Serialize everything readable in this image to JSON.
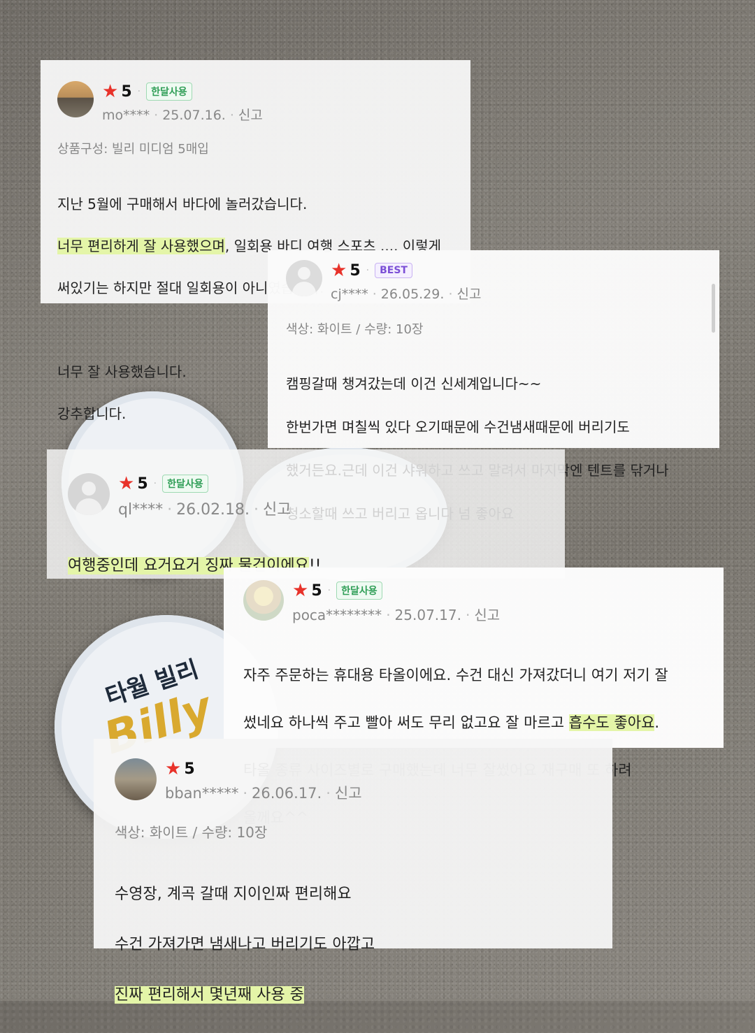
{
  "reviews": [
    {
      "score": "5",
      "badge": "한달사용",
      "user": "mo****",
      "date": "25.07.16.",
      "report": "신고",
      "option": "상품구성: 빌리 미디엄 5매입",
      "line1": "지난 5월에 구매해서 바다에 놀러갔습니다.",
      "line2_hl": "너무 편리하게 잘 사용했으며",
      "line2_rest": ", 일회용 바디 여행 스포츠 .... 이렇게",
      "line3": "써있기는 하지만 절대 일회용이 아니였습니다.",
      "line4": "너무 잘 사용했습니다.",
      "line5": "강추합니다."
    },
    {
      "score": "5",
      "badge": "BEST",
      "user": "cj****",
      "date": "26.05.29.",
      "report": "신고",
      "option": "색상: 화이트 / 수량: 10장",
      "line1": "캠핑갈때 챙겨갔는데 이건 신세계입니다~~",
      "line2": "한번가면 며칠씩 있다 오기때문에 수건냄새때문에 버리기도",
      "line3": "했거든요.근데 이건 샤워하고 쓰고 말려서 마지막엔 텐트를 닦거나",
      "line4": "청소할때 쓰고 버리고 옵니다 넘 좋아요"
    },
    {
      "score": "5",
      "badge": "한달사용",
      "user": "ql****",
      "date": "26.02.18.",
      "report": "신고",
      "line1_hl": "여행중인데 요거요거 징짜 물건이에요",
      "line1_rest": "!!"
    },
    {
      "score": "5",
      "badge": "한달사용",
      "user": "poca********",
      "date": "25.07.17.",
      "report": "신고",
      "line1": "자주 주문하는 휴대용 타올이에요. 수건 대신 가져갔더니 여기 저기 잘",
      "line2_pre": "썼네요 하나씩 주고 빨아 써도 무리 없고요 잘 마르고 ",
      "line2_hl": "흡수도 좋아요",
      "line2_post": ".",
      "line3": "타올 종류 사이즈별로 구매했는데 너무 잘썼어요 재구매 또 하려",
      "line4": "올께요^^"
    },
    {
      "score": "5",
      "user": "bban*****",
      "date": "26.06.17.",
      "report": "신고",
      "option": "색상: 화이트 / 수량: 10장",
      "line1": "수영장, 계곡 갈때 지이인짜 편리해요",
      "line2": "수건 가져가면 냄새나고 버리기도 아깝고",
      "line3_hl": "진짜 편리해서 몇년째 사용 중"
    }
  ],
  "product": {
    "label_kr": "타월 빌리",
    "label_en": "Billy"
  },
  "colors": {
    "star": "#e8322a",
    "highlight": "#e4f5a8",
    "badge_month": "#2f9e56",
    "badge_best": "#7b4fd6"
  }
}
